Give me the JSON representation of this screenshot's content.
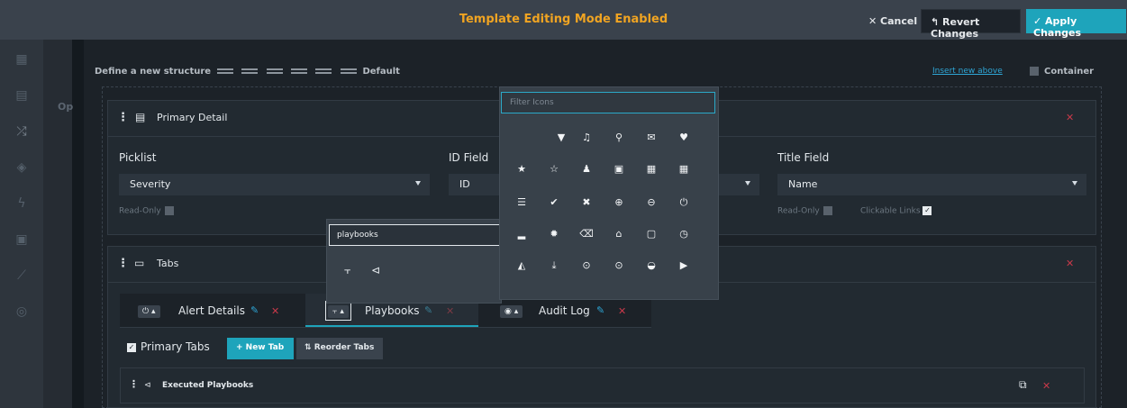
{
  "topbar": {
    "title": "Template Editing Mode Enabled",
    "cancel_label": "Cancel",
    "revert_label": "Revert Changes",
    "apply_label": "Apply Changes"
  },
  "sidebar": {
    "truncated_label": "Op",
    "icons": [
      "grid-icon",
      "layers-icon",
      "shuffle-icon",
      "shield-icon",
      "bolt-icon",
      "briefcase-icon",
      "chart-icon",
      "settings-icon"
    ]
  },
  "structure": {
    "label": "Define a new structure",
    "default_label": "Default",
    "right_link": "Insert new above",
    "container_label": "Container"
  },
  "primary_detail": {
    "title": "Primary Detail",
    "fields": [
      {
        "label": "Picklist",
        "value": "Severity",
        "footer": "Read-Only"
      },
      {
        "label": "ID Field",
        "value": "ID"
      },
      {
        "label": "Title Field",
        "value": "Name",
        "footer": "Read-Only",
        "footer2": "Clickable Links"
      }
    ]
  },
  "tabs_panel": {
    "title": "Tabs",
    "tabs": [
      {
        "label": "Alert Details"
      },
      {
        "label": "Playbooks"
      },
      {
        "label": "Audit Log"
      }
    ],
    "primary_tabs_label": "Primary Tabs",
    "new_tab_label": "+ New Tab",
    "reorder_label": "Reorder Tabs",
    "executed_label": "Executed Playbooks"
  },
  "icon_picker": {
    "placeholder": "Filter Icons"
  },
  "playbook_popup": {
    "query": "playbooks"
  },
  "colors": {
    "accent": "#1ea4bb",
    "warning": "#f0a422",
    "danger": "#c7394a"
  }
}
